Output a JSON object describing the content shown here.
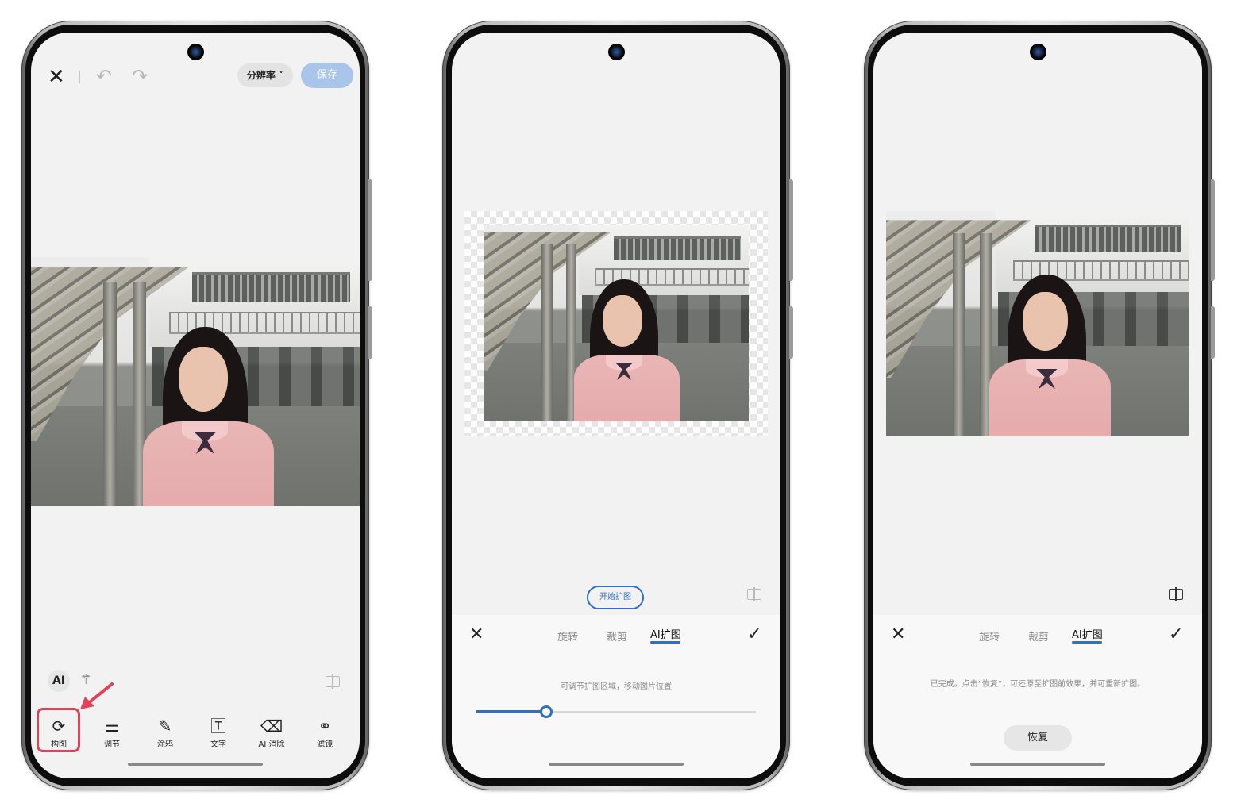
{
  "phone1": {
    "toolbar": {
      "resolution_label": "分辨率",
      "save_label": "保存"
    },
    "ai_label": "AI",
    "tools": [
      {
        "label": "构图",
        "icon": "crop-rotate-icon"
      },
      {
        "label": "调节",
        "icon": "sliders-icon"
      },
      {
        "label": "涂鸦",
        "icon": "pen-icon"
      },
      {
        "label": "文字",
        "icon": "text-box-icon"
      },
      {
        "label": "AI 消除",
        "icon": "eraser-icon"
      },
      {
        "label": "滤镜",
        "icon": "filter-circles-icon"
      }
    ],
    "highlight_color": "#e0425a"
  },
  "phone2": {
    "start_button": "开始扩图",
    "tabs": [
      "旋转",
      "裁剪",
      "AI扩图"
    ],
    "active_tab": "AI扩图",
    "hint": "可调节扩图区域，移动图片位置",
    "slider_value": 0.25,
    "accent_color": "#2f6fc5"
  },
  "phone3": {
    "tabs": [
      "旋转",
      "裁剪",
      "AI扩图"
    ],
    "active_tab": "AI扩图",
    "hint": "已完成。点击“恢复”，可还原至扩图前效果，并可重新扩图。",
    "restore_label": "恢复"
  }
}
